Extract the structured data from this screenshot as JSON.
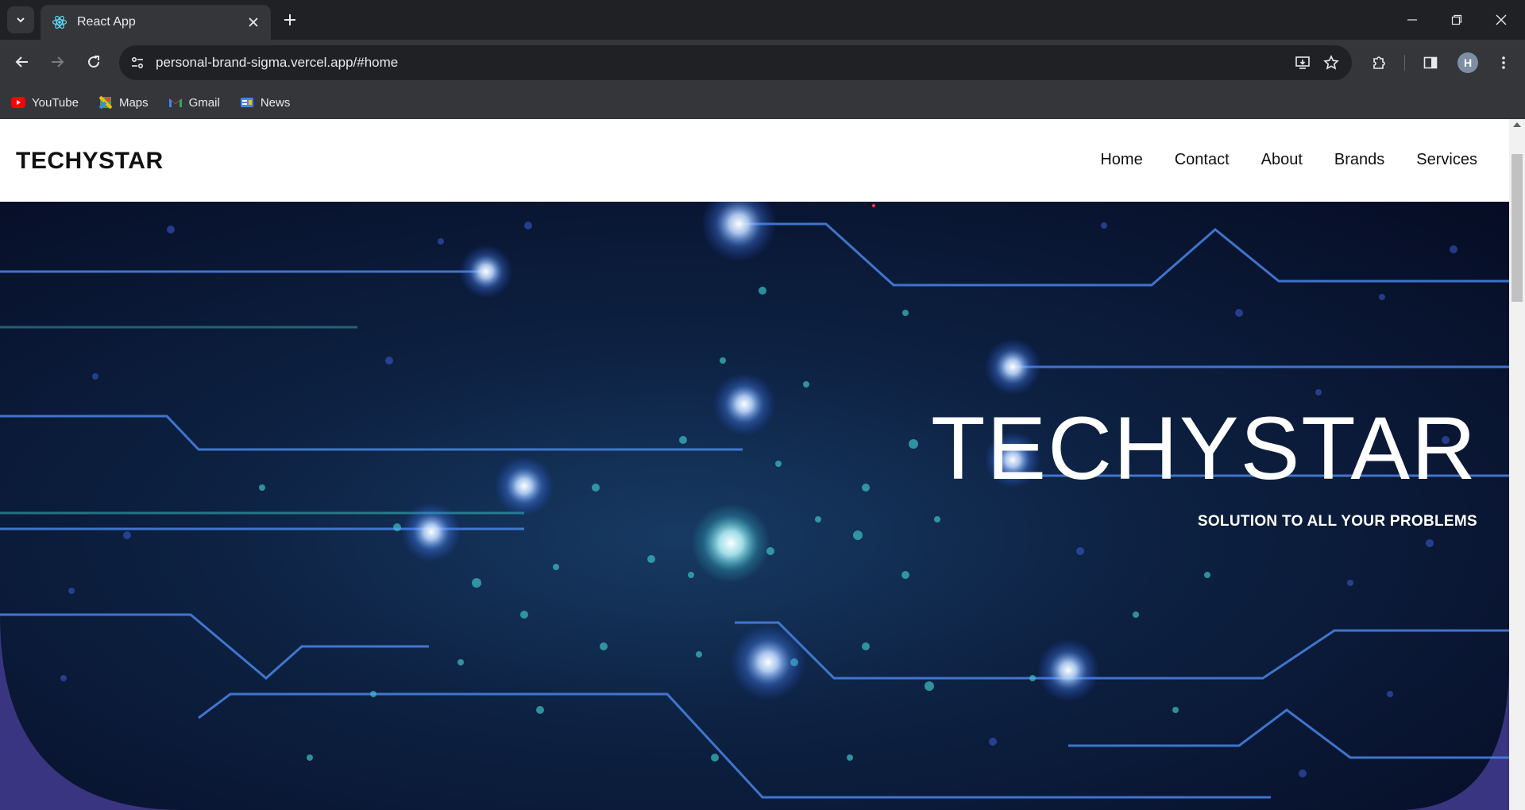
{
  "browser": {
    "tab_title": "React App",
    "url": "personal-brand-sigma.vercel.app/#home",
    "avatar_initial": "H",
    "bookmarks": [
      {
        "label": "YouTube",
        "icon": "youtube-icon"
      },
      {
        "label": "Maps",
        "icon": "maps-icon"
      },
      {
        "label": "Gmail",
        "icon": "gmail-icon"
      },
      {
        "label": "News",
        "icon": "news-icon"
      }
    ]
  },
  "site": {
    "brand": "TECHYSTAR",
    "nav": [
      {
        "label": "Home"
      },
      {
        "label": "Contact"
      },
      {
        "label": "About"
      },
      {
        "label": "Brands"
      },
      {
        "label": "Services"
      }
    ],
    "hero": {
      "title": "TECHYSTAR",
      "subtitle": "SOLUTION TO ALL YOUR PROBLEMS"
    }
  },
  "colors": {
    "chrome_dark": "#202124",
    "chrome_toolbar": "#35363a",
    "hero_bg": "#0d2142",
    "circuit_glow": "#6ea8ff",
    "accent_purple": "#3a3580"
  }
}
